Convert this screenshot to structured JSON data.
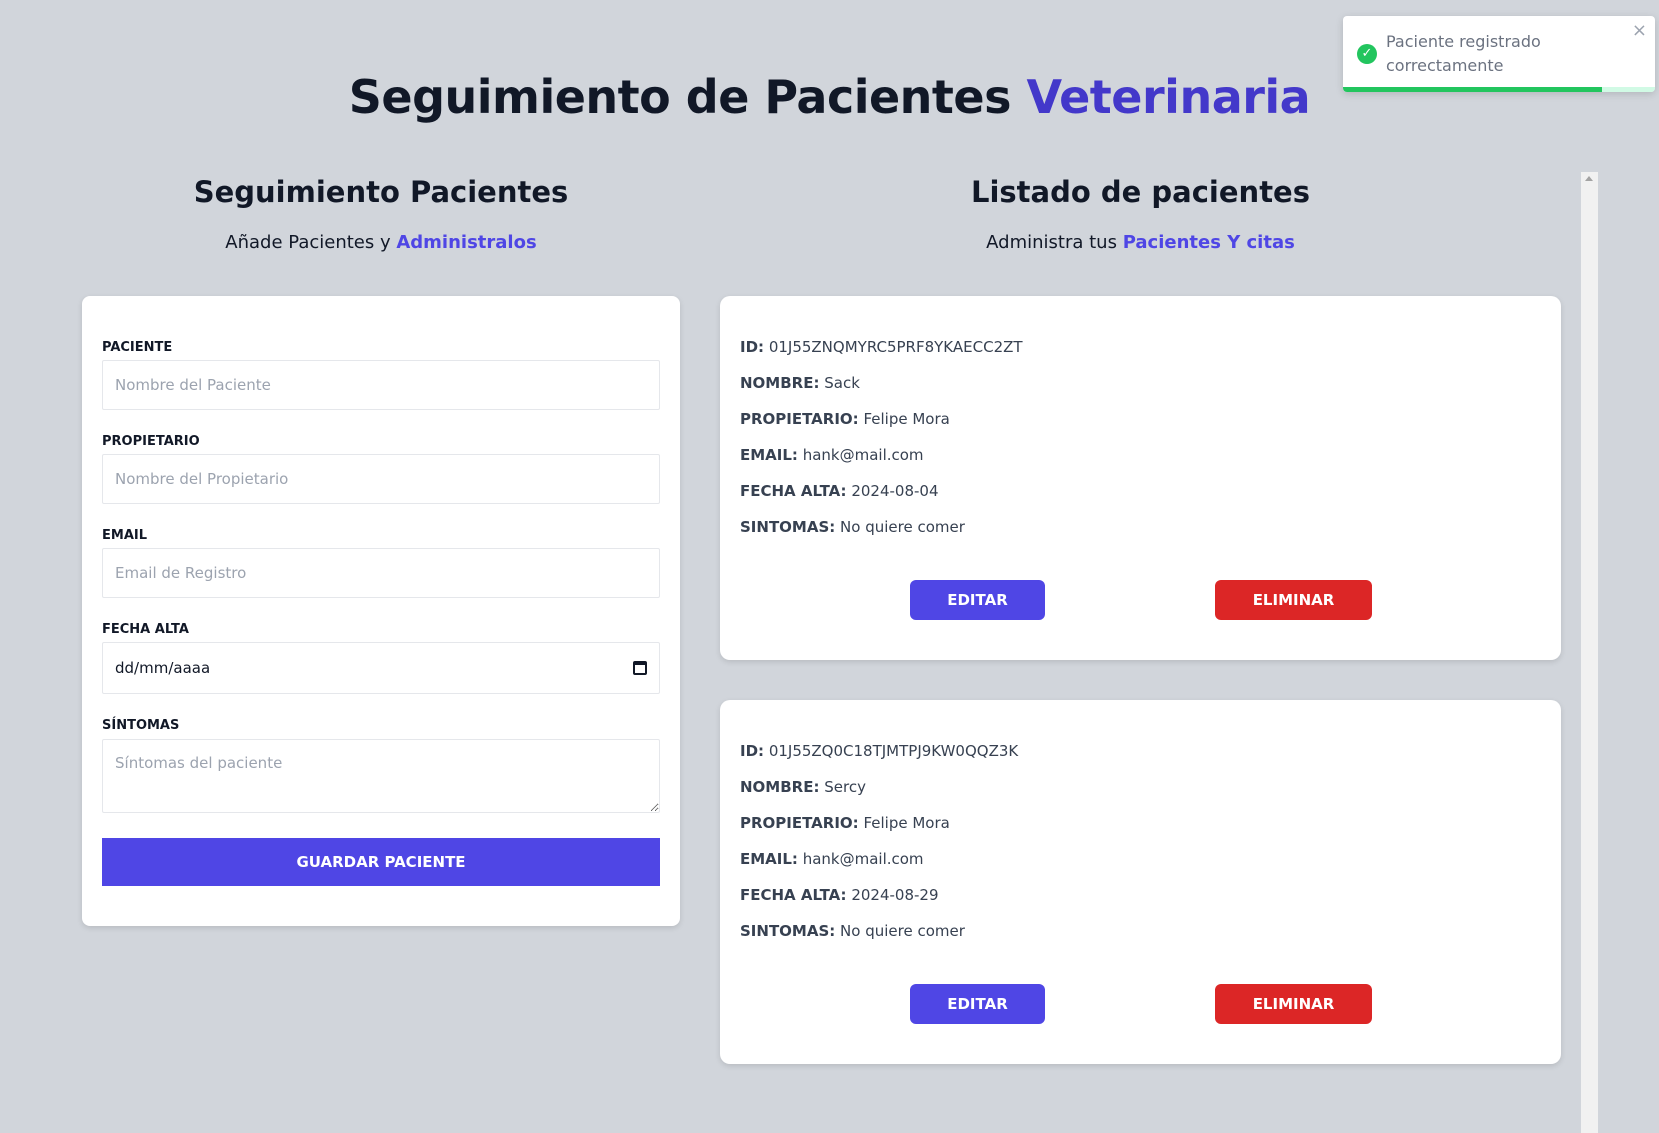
{
  "header": {
    "title_main": "Seguimiento de Pacientes",
    "title_accent": "Veterinaria"
  },
  "form_section": {
    "heading": "Seguimiento Pacientes",
    "subtitle_text": "Añade Pacientes y",
    "subtitle_accent": "Administralos"
  },
  "list_section": {
    "heading": "Listado de pacientes",
    "subtitle_text": "Administra tus",
    "subtitle_accent": "Pacientes Y citas"
  },
  "form": {
    "paciente_label": "PACIENTE",
    "paciente_placeholder": "Nombre del Paciente",
    "propietario_label": "PROPIETARIO",
    "propietario_placeholder": "Nombre del Propietario",
    "email_label": "EMAIL",
    "email_placeholder": "Email de Registro",
    "fecha_label": "FECHA ALTA",
    "fecha_placeholder": "dd/mm/aaaa",
    "sintomas_label": "SÍNTOMAS",
    "sintomas_placeholder": "Síntomas del paciente",
    "submit_label": "GUARDAR PACIENTE"
  },
  "patients": [
    {
      "id_label": "ID:",
      "id": "01J55ZNQMYRC5PRF8YKAECC2ZT",
      "nombre_label": "NOMBRE:",
      "nombre": "Sack",
      "propietario_label": "PROPIETARIO:",
      "propietario": "Felipe Mora",
      "email_label": "EMAIL:",
      "email": "hank@mail.com",
      "fecha_label": "FECHA ALTA:",
      "fecha": "2024-08-04",
      "sintomas_label": "SINTOMAS:",
      "sintomas": "No quiere comer",
      "edit_label": "EDITAR",
      "delete_label": "ELIMINAR"
    },
    {
      "id_label": "ID:",
      "id": "01J55ZQ0C18TJMTPJ9KW0QQZ3K",
      "nombre_label": "NOMBRE:",
      "nombre": "Sercy",
      "propietario_label": "PROPIETARIO:",
      "propietario": "Felipe Mora",
      "email_label": "EMAIL:",
      "email": "hank@mail.com",
      "fecha_label": "FECHA ALTA:",
      "fecha": "2024-08-29",
      "sintomas_label": "SINTOMAS:",
      "sintomas": "No quiere comer",
      "edit_label": "EDITAR",
      "delete_label": "ELIMINAR"
    }
  ],
  "toast": {
    "message": "Paciente registrado correctamente",
    "close": "×",
    "icon": "check-circle-icon",
    "progress_fraction": 0.83
  },
  "colors": {
    "accent": "#4338ca",
    "primary_button": "#4f46e5",
    "danger_button": "#dc2626",
    "success": "#22c55e",
    "background": "#d1d5db"
  }
}
